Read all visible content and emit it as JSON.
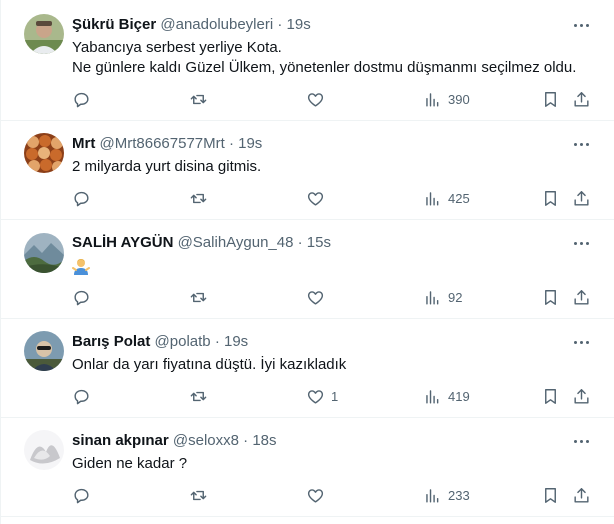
{
  "tweets": [
    {
      "name": "Şükrü Biçer",
      "handle": "@anadolubeyleri",
      "dot": "·",
      "time": "19s",
      "lines": [
        "Yabancıya serbest yerliye Kota.",
        "Ne günlere kaldı Güzel Ülkem, yönetenler dostmu düşmanmı seçilmez oldu."
      ],
      "likes": "",
      "views": "390",
      "avatar_colors": [
        "#8aa06b",
        "#c9a58a",
        "#5a4a3c"
      ]
    },
    {
      "name": "Mrt",
      "handle": "@Mrt86667577Mrt",
      "dot": "·",
      "time": "19s",
      "lines": [
        "2 milyarda yurt disina gitmis."
      ],
      "likes": "",
      "views": "425",
      "avatar_colors": [
        "#c96a2b",
        "#e2a46a",
        "#8c3f18"
      ]
    },
    {
      "name": "SALİH AYGÜN",
      "handle": "@SalihAygun_48",
      "dot": "·",
      "time": "15s",
      "lines": [
        ""
      ],
      "emoji": "person-shrugging-emoji",
      "likes": "",
      "views": "92",
      "avatar_colors": [
        "#6f8b9c",
        "#4d6b3f",
        "#9fb3c1"
      ]
    },
    {
      "name": "Barış Polat",
      "handle": "@polatb",
      "dot": "·",
      "time": "19s",
      "lines": [
        "Onlar da yarı fiyatına düştü. İyi kazıkladık"
      ],
      "likes": "1",
      "views": "419",
      "avatar_colors": [
        "#7d9bb0",
        "#4b5a3a",
        "#d8c3a8"
      ]
    },
    {
      "name": "sinan akpınar",
      "handle": "@seloxx8",
      "dot": "·",
      "time": "18s",
      "lines": [
        "Giden ne kadar ?"
      ],
      "likes": "",
      "views": "233",
      "avatar_colors": [
        "#e8e8ea",
        "#c8c8cc",
        "#f5f5f7"
      ]
    }
  ]
}
